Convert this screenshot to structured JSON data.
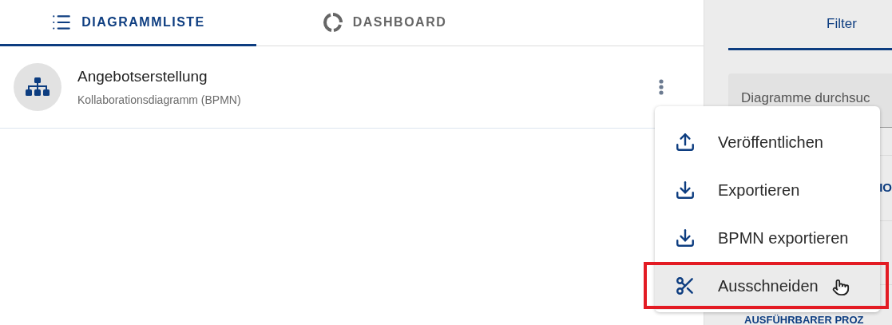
{
  "tabs": [
    {
      "label": "DIAGRAMMLISTE",
      "kind": "list",
      "selected": true
    },
    {
      "label": "DASHBOARD",
      "kind": "dashboard",
      "selected": false
    }
  ],
  "diagrams": [
    {
      "title": "Angebotserstellung",
      "subtitle": "Kollaborationsdiagramm (BPMN)"
    }
  ],
  "context_menu": {
    "items": [
      {
        "label": "Veröffentlichen",
        "kind": "publish",
        "selected": false
      },
      {
        "label": "Exportieren",
        "kind": "export",
        "selected": false
      },
      {
        "label": "BPMN exportieren",
        "kind": "export",
        "selected": false
      },
      {
        "label": "Ausschneiden",
        "kind": "cut",
        "selected": true
      }
    ]
  },
  "filter_panel": {
    "tab": "Filter",
    "search": {
      "placeholder": "Diagramme durchsuc"
    },
    "section_fragment": "IO",
    "bottom_heading": "AUSFÜHRBARER PROZ"
  }
}
